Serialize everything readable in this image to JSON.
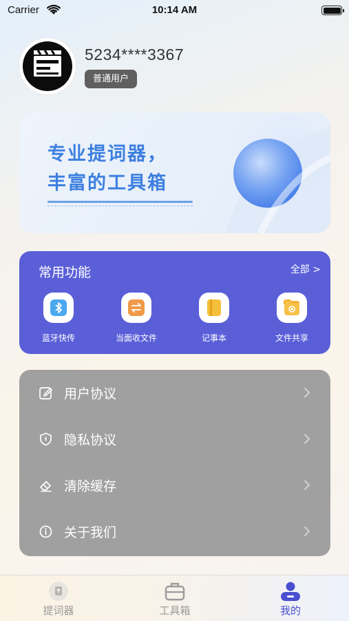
{
  "status_bar": {
    "carrier": "Carrier",
    "time": "10:14 AM"
  },
  "profile": {
    "phone": "5234****3367",
    "user_type": "普通用户"
  },
  "banner": {
    "line1": "专业提词器，",
    "line2": "丰富的工具箱"
  },
  "features": {
    "title": "常用功能",
    "all_label": "全部 >",
    "items": [
      {
        "label": "蓝牙快传",
        "icon": "bluetooth-icon",
        "color": "#3a9fe8"
      },
      {
        "label": "当面收文件",
        "icon": "transfer-icon",
        "color": "#ef8a3c"
      },
      {
        "label": "记事本",
        "icon": "notebook-icon",
        "color": "#f2b52c"
      },
      {
        "label": "文件共享",
        "icon": "file-share-icon",
        "color": "#f5b63d"
      }
    ]
  },
  "menu": {
    "items": [
      {
        "label": "用户协议",
        "icon": "edit-icon"
      },
      {
        "label": "隐私协议",
        "icon": "shield-icon"
      },
      {
        "label": "清除缓存",
        "icon": "eraser-icon"
      },
      {
        "label": "关于我们",
        "icon": "info-icon"
      }
    ]
  },
  "tabbar": {
    "items": [
      {
        "label": "提词器",
        "icon": "prompter-icon",
        "active": false
      },
      {
        "label": "工具箱",
        "icon": "toolbox-icon",
        "active": false
      },
      {
        "label": "我的",
        "icon": "profile-icon",
        "active": true
      }
    ]
  },
  "colors": {
    "accent": "#5a5fd8",
    "banner_text": "#3d7fe0",
    "menu_background": "#a0a0a0",
    "tab_active": "#4a4fd0",
    "tab_inactive": "#9a9a9a"
  }
}
